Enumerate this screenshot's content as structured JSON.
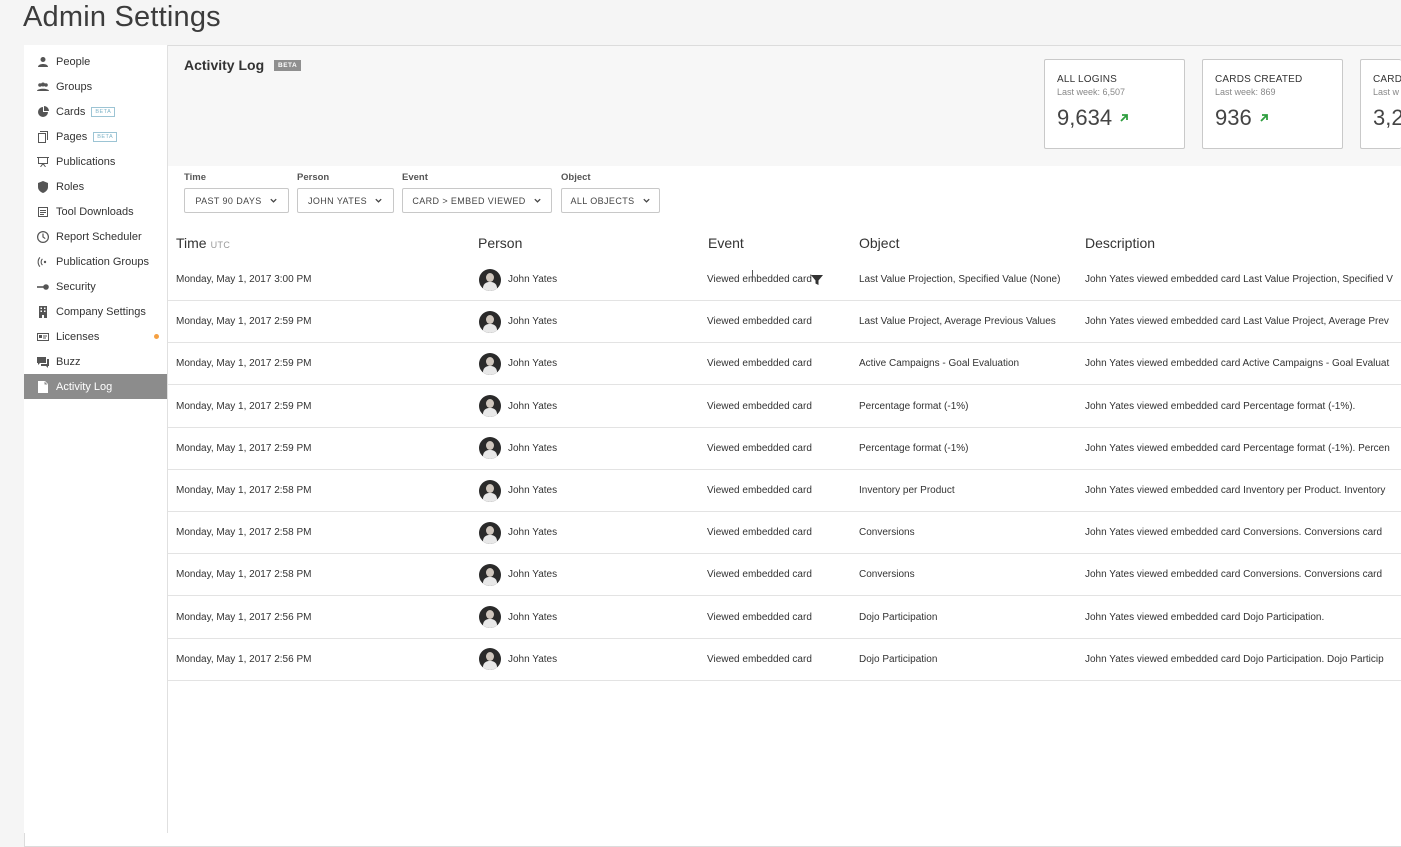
{
  "page_title": "Admin Settings",
  "sidebar": {
    "items": [
      {
        "label": "People",
        "icon": "person-icon",
        "beta": ""
      },
      {
        "label": "Groups",
        "icon": "groups-icon",
        "beta": ""
      },
      {
        "label": "Cards",
        "icon": "pie-chart-icon",
        "beta": "BETA"
      },
      {
        "label": "Pages",
        "icon": "pages-icon",
        "beta": "BETA"
      },
      {
        "label": "Publications",
        "icon": "presentation-icon",
        "beta": ""
      },
      {
        "label": "Roles",
        "icon": "shield-icon",
        "beta": ""
      },
      {
        "label": "Tool Downloads",
        "icon": "download-box-icon",
        "beta": ""
      },
      {
        "label": "Report Scheduler",
        "icon": "clock-icon",
        "beta": ""
      },
      {
        "label": "Publication Groups",
        "icon": "broadcast-icon",
        "beta": ""
      },
      {
        "label": "Security",
        "icon": "key-icon",
        "beta": ""
      },
      {
        "label": "Company Settings",
        "icon": "building-icon",
        "beta": ""
      },
      {
        "label": "Licenses",
        "icon": "id-card-icon",
        "beta": ""
      },
      {
        "label": "Buzz",
        "icon": "chat-icon",
        "beta": ""
      },
      {
        "label": "Activity Log",
        "icon": "document-icon",
        "beta": ""
      }
    ],
    "active_index": 13,
    "licenses_dot_color": "#f5a042"
  },
  "header": {
    "title": "Activity Log",
    "beta": "BETA"
  },
  "stats": [
    {
      "title": "ALL LOGINS",
      "sub": "Last week: 6,507",
      "value": "9,634"
    },
    {
      "title": "CARDS CREATED",
      "sub": "Last week: 869",
      "value": "936"
    },
    {
      "title": "CARD",
      "sub": "Last w",
      "value": "3,2"
    }
  ],
  "trend_color": "#2e9e3e",
  "filters": [
    {
      "label": "Time",
      "value": "PAST 90 DAYS"
    },
    {
      "label": "Person",
      "value": "JOHN YATES"
    },
    {
      "label": "Event",
      "value": "CARD > EMBED VIEWED"
    },
    {
      "label": "Object",
      "value": "ALL OBJECTS"
    }
  ],
  "table": {
    "headers": {
      "time": "Time",
      "utc": "UTC",
      "person": "Person",
      "event": "Event",
      "object": "Object",
      "description": "Description"
    },
    "rows": [
      {
        "time": "Monday, May 1, 2017 3:00 PM",
        "person": "John Yates",
        "event": "Viewed embedded card",
        "object": "Last Value Projection, Specified Value (None)",
        "description": "John Yates viewed embedded card Last Value Projection, Specified V"
      },
      {
        "time": "Monday, May 1, 2017 2:59 PM",
        "person": "John Yates",
        "event": "Viewed embedded card",
        "object": "Last Value Project, Average Previous Values",
        "description": "John Yates viewed embedded card Last Value Project, Average Prev"
      },
      {
        "time": "Monday, May 1, 2017 2:59 PM",
        "person": "John Yates",
        "event": "Viewed embedded card",
        "object": "Active Campaigns - Goal Evaluation",
        "description": "John Yates viewed embedded card Active Campaigns - Goal Evaluat"
      },
      {
        "time": "Monday, May 1, 2017 2:59 PM",
        "person": "John Yates",
        "event": "Viewed embedded card",
        "object": "Percentage format (-1%)",
        "description": "John Yates viewed embedded card Percentage format (-1%)."
      },
      {
        "time": "Monday, May 1, 2017 2:59 PM",
        "person": "John Yates",
        "event": "Viewed embedded card",
        "object": "Percentage format (-1%)",
        "description": "John Yates viewed embedded card Percentage format (-1%). Percen"
      },
      {
        "time": "Monday, May 1, 2017 2:58 PM",
        "person": "John Yates",
        "event": "Viewed embedded card",
        "object": "Inventory per Product",
        "description": "John Yates viewed embedded card Inventory per Product. Inventory"
      },
      {
        "time": "Monday, May 1, 2017 2:58 PM",
        "person": "John Yates",
        "event": "Viewed embedded card",
        "object": "Conversions",
        "description": "John Yates viewed embedded card Conversions. Conversions card"
      },
      {
        "time": "Monday, May 1, 2017 2:58 PM",
        "person": "John Yates",
        "event": "Viewed embedded card",
        "object": "Conversions",
        "description": "John Yates viewed embedded card Conversions. Conversions card"
      },
      {
        "time": "Monday, May 1, 2017 2:56 PM",
        "person": "John Yates",
        "event": "Viewed embedded card",
        "object": "Dojo Participation",
        "description": "John Yates viewed embedded card Dojo Participation."
      },
      {
        "time": "Monday, May 1, 2017 2:56 PM",
        "person": "John Yates",
        "event": "Viewed embedded card",
        "object": "Dojo Participation",
        "description": "John Yates viewed embedded card Dojo Participation. Dojo Particip"
      }
    ]
  }
}
